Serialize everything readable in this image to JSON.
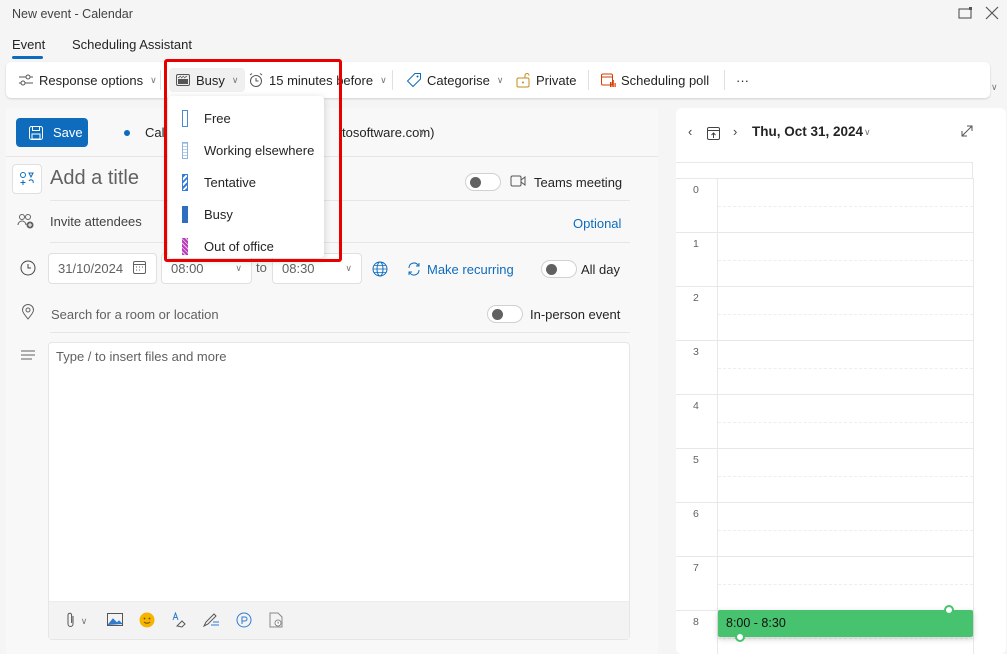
{
  "window": {
    "title": "New event - Calendar",
    "popout_icon": "popout-icon",
    "close_icon": "close-icon"
  },
  "tabs": [
    {
      "label": "Event",
      "active": true
    },
    {
      "label": "Scheduling Assistant",
      "active": false
    }
  ],
  "ribbon": {
    "response_options": "Response options",
    "show_as": "Busy",
    "reminder": "15 minutes before",
    "categorise": "Categorise",
    "private": "Private",
    "scheduling_poll": "Scheduling poll",
    "more": "···"
  },
  "show_as_menu": {
    "items": [
      {
        "label": "Free",
        "color": "#4f8ad0"
      },
      {
        "label": "Working elsewhere",
        "color": "#8fb4e0"
      },
      {
        "label": "Tentative",
        "color": "#3a7bd5"
      },
      {
        "label": "Busy",
        "color": "#2f6fc0"
      },
      {
        "label": "Out of office",
        "color": "#b83db8"
      }
    ],
    "selected": "Busy"
  },
  "form": {
    "save_label": "Save",
    "calendar_visible_prefix": "Cal",
    "calendar_visible_suffix": "tosoftware.com)",
    "title_placeholder": "Add a title",
    "teams_meeting_label": "Teams meeting",
    "teams_meeting_on": false,
    "attendees_placeholder": "Invite attendees",
    "optional_label": "Optional",
    "date": "31/10/2024",
    "start_time": "08:00",
    "to_label": "to",
    "end_time": "08:30",
    "make_recurring": "Make recurring",
    "all_day_label": "All day",
    "all_day_on": false,
    "location_placeholder": "Search for a room or location",
    "in_person_label": "In-person event",
    "in_person_on": false,
    "body_placeholder": "Type / to insert files and more"
  },
  "calendar": {
    "date_label": "Thu, Oct 31, 2024",
    "hours": [
      "0",
      "1",
      "2",
      "3",
      "4",
      "5",
      "6",
      "7",
      "8"
    ],
    "event": {
      "label": "8:00 - 8:30",
      "color": "#47c26e"
    }
  },
  "colors": {
    "accent": "#0f6cbd",
    "highlight_border": "#e60000"
  }
}
